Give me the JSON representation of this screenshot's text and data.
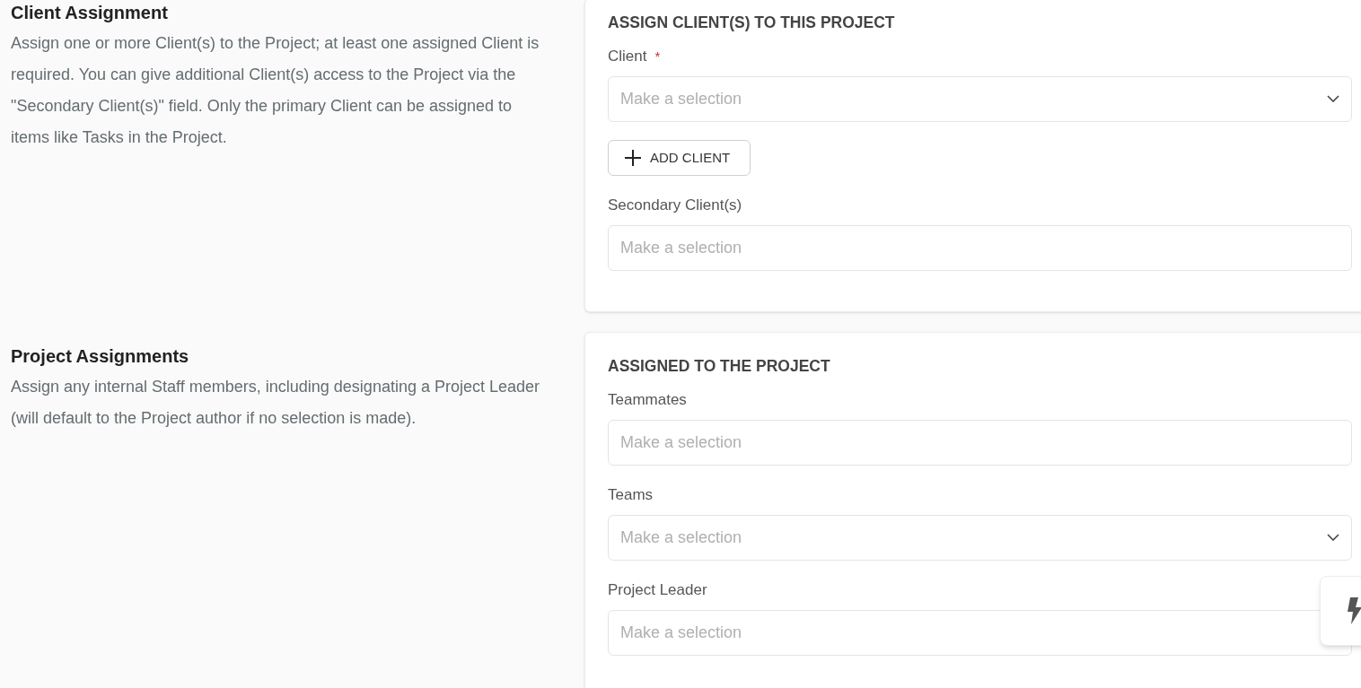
{
  "sections": [
    {
      "title": "Client Assignment",
      "description": "Assign one or more Client(s) to the Project; at least one assigned Client is required. You can give additional Client(s) access to the Project via the \"Secondary Client(s)\" field. Only the primary Client can be assigned to items like Tasks in the Project.",
      "card_heading": "ASSIGN CLIENT(S) TO THIS PROJECT",
      "fields": [
        {
          "label": "Client",
          "required_mark": "*",
          "kind": "select",
          "placeholder": "Make a selection",
          "button": "ADD CLIENT"
        },
        {
          "label": "Secondary Client(s)",
          "kind": "multi",
          "placeholder": "Make a selection"
        }
      ]
    },
    {
      "title": "Project Assignments",
      "description": "Assign any internal Staff members, including designating a Project Leader (will default to the Project author if no selection is made).",
      "card_heading": "ASSIGNED TO THE PROJECT",
      "fields": [
        {
          "label": "Teammates",
          "kind": "multi",
          "placeholder": "Make a selection"
        },
        {
          "label": "Teams",
          "kind": "select",
          "placeholder": "Make a selection"
        },
        {
          "label": "Project Leader",
          "kind": "multi",
          "placeholder": "Make a selection"
        }
      ]
    }
  ]
}
